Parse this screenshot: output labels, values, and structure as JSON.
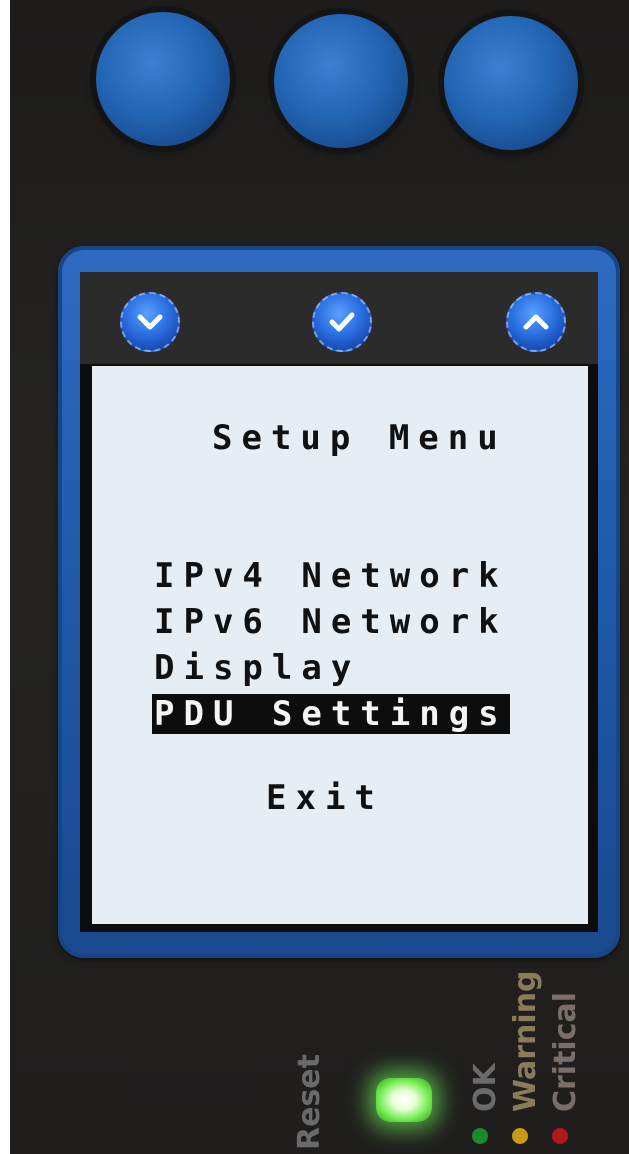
{
  "screen": {
    "title": "Setup Menu",
    "softkeys": [
      {
        "icon": "chevron-down-icon"
      },
      {
        "icon": "checkmark-icon"
      },
      {
        "icon": "chevron-up-icon"
      }
    ],
    "menu_items": [
      {
        "label": "IPv4 Network",
        "selected": false
      },
      {
        "label": "IPv6 Network",
        "selected": false
      },
      {
        "label": "Display",
        "selected": false
      },
      {
        "label": "PDU Settings",
        "selected": true
      }
    ],
    "exit_label": "Exit"
  },
  "panel": {
    "reset_label": "Reset",
    "status_indicators": [
      {
        "label": "OK",
        "color": "#1d8a2a"
      },
      {
        "label": "Warning",
        "color": "#c99a18"
      },
      {
        "label": "Critical",
        "color": "#b41818"
      }
    ]
  },
  "colors": {
    "button_blue": "#2466b6",
    "bezel_blue": "#1f58a8",
    "lcd_background": "#e6eef4",
    "reset_led_green": "#7cf05a"
  }
}
